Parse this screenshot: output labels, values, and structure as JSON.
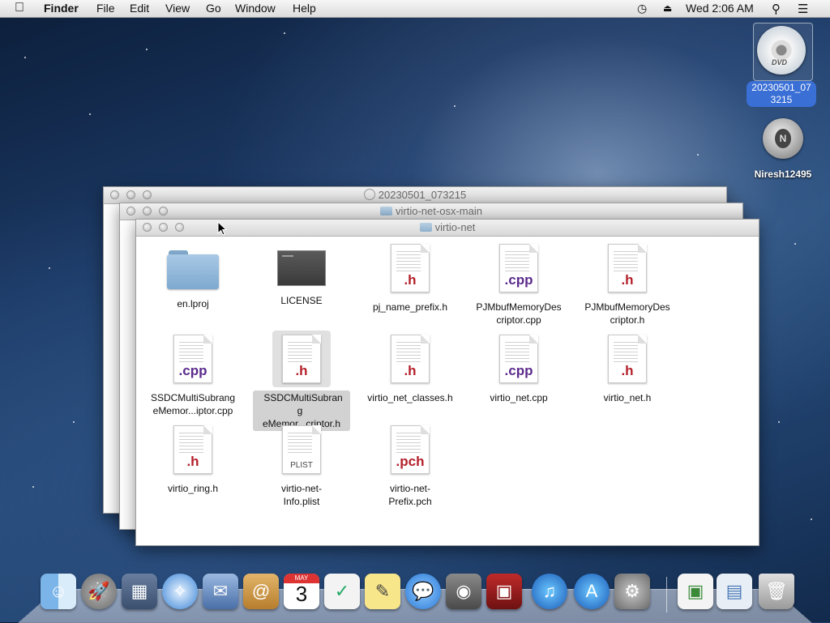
{
  "menubar": {
    "apple": "",
    "app": "Finder",
    "items": [
      "File",
      "Edit",
      "View",
      "Go",
      "Window",
      "Help"
    ],
    "clock": "Wed 2:06 AM"
  },
  "desktop": {
    "dvd": {
      "label_line1": "20230501_07",
      "label_line2": "3215",
      "badge": "DVD"
    },
    "network": {
      "label": "Niresh12495",
      "letter": "N"
    }
  },
  "windows": {
    "back": {
      "title": "20230501_073215"
    },
    "middle": {
      "title": "virtio-net-osx-main"
    },
    "front": {
      "title": "virtio-net"
    }
  },
  "files": [
    {
      "name_l1": "en.lproj",
      "name_l2": "",
      "kind": "folder",
      "ext": ""
    },
    {
      "name_l1": "LICENSE",
      "name_l2": "",
      "kind": "exec",
      "ext": ""
    },
    {
      "name_l1": "pj_name_prefix.h",
      "name_l2": "",
      "kind": "doc",
      "ext": ".h"
    },
    {
      "name_l1": "PJMbufMemoryDes",
      "name_l2": "criptor.cpp",
      "kind": "doc",
      "ext": ".cpp"
    },
    {
      "name_l1": "PJMbufMemoryDes",
      "name_l2": "criptor.h",
      "kind": "doc",
      "ext": ".h"
    },
    {
      "name_l1": "SSDCMultiSubrang",
      "name_l2": "eMemor...iptor.cpp",
      "kind": "doc",
      "ext": ".cpp"
    },
    {
      "name_l1": "SSDCMultiSubrang",
      "name_l2": "eMemor...criptor.h",
      "kind": "doc",
      "ext": ".h"
    },
    {
      "name_l1": "virtio_net_classes.h",
      "name_l2": "",
      "kind": "doc",
      "ext": ".h"
    },
    {
      "name_l1": "virtio_net.cpp",
      "name_l2": "",
      "kind": "doc",
      "ext": ".cpp"
    },
    {
      "name_l1": "virtio_net.h",
      "name_l2": "",
      "kind": "doc",
      "ext": ".h"
    },
    {
      "name_l1": "virtio_ring.h",
      "name_l2": "",
      "kind": "doc",
      "ext": ".h"
    },
    {
      "name_l1": "virtio-net-",
      "name_l2": "Info.plist",
      "kind": "doc",
      "ext": "PLIST"
    },
    {
      "name_l1": "virtio-net-",
      "name_l2": "Prefix.pch",
      "kind": "doc",
      "ext": ".pch"
    }
  ],
  "dock": {
    "calendar_day": "3",
    "calendar_month": "MAY"
  }
}
